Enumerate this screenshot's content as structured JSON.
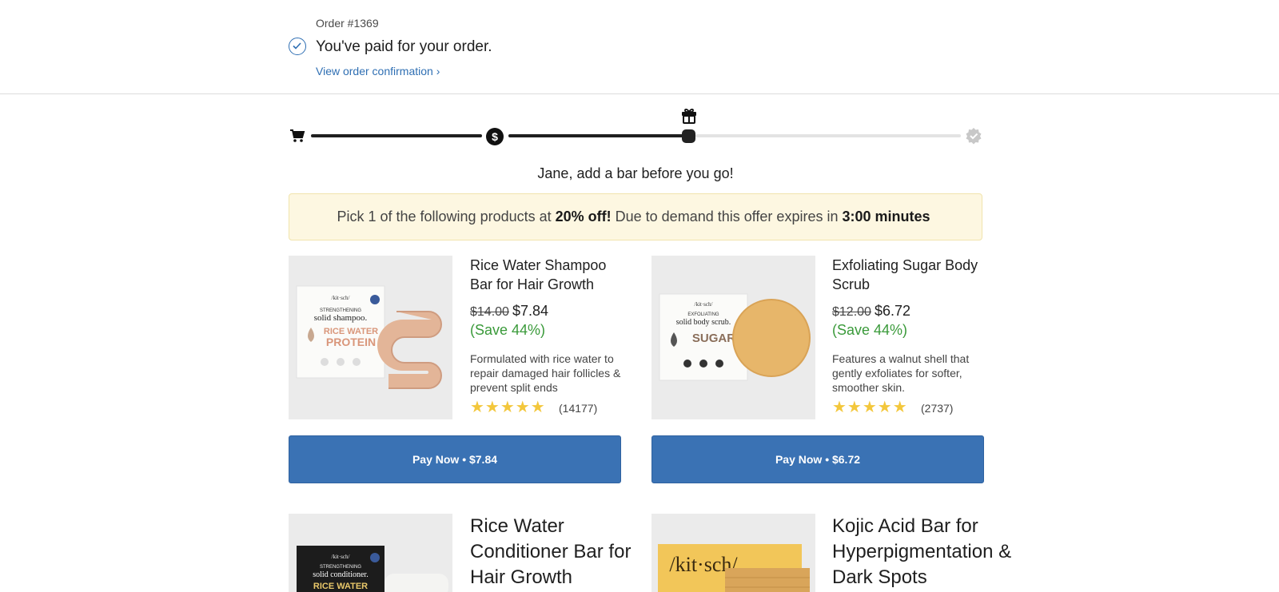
{
  "order": {
    "number": "Order #1369",
    "paid_message": "You've paid for your order.",
    "confirmation_link": "View order confirmation ›"
  },
  "progress": {
    "steps": [
      "cart-icon",
      "dollar-icon",
      "gift-icon",
      "verified-badge-icon"
    ],
    "current_step": 3
  },
  "headline": "Jane, add a bar before you go!",
  "offer": {
    "prefix": "Pick 1 of the following products at",
    "discount": "20% off!",
    "middle": "Due to demand this offer expires in",
    "timer": "3:00 minutes"
  },
  "products": [
    {
      "title": "Rice Water Shampoo Bar for Hair Growth",
      "old_price": "$14.00",
      "new_price": "$7.84",
      "save": "(Save 44%)",
      "description": "Formulated with rice water to repair damaged hair follicles & prevent split ends",
      "rating": 5,
      "stars": "★★★★★",
      "reviews": "(14177)",
      "button": "Pay Now • $7.84",
      "pkg_brand": "/kit·sch/",
      "pkg_line1": "STRENGTHENING",
      "pkg_line2": "solid shampoo.",
      "pkg_line3": "RICE WATER",
      "pkg_line4": "PROTEIN"
    },
    {
      "title": "Exfoliating Sugar Body Scrub",
      "old_price": "$12.00",
      "new_price": "$6.72",
      "save": "(Save 44%)",
      "description": "Features a walnut shell that gently exfoliates for softer, smoother skin.",
      "rating": 5,
      "stars": "★★★★★",
      "reviews": "(2737)",
      "button": "Pay Now • $6.72",
      "pkg_brand": "/kit·sch/",
      "pkg_line1": "EXFOLIATING",
      "pkg_line2": "solid body scrub.",
      "pkg_line3": "SUGAR"
    },
    {
      "title": "Rice Water Conditioner Bar for Hair Growth",
      "pkg_brand": "/kit·sch/",
      "pkg_line1": "STRENGTHENING",
      "pkg_line2": "solid conditioner.",
      "pkg_line3": "RICE WATER"
    },
    {
      "title": "Kojic Acid Bar for Hyperpigmentation & Dark Spots",
      "pkg_brand": "/kit·sch/"
    }
  ],
  "colors": {
    "accent": "#3a72b4",
    "link": "#2f6fb3",
    "save_green": "#3a9a3a",
    "star": "#f3c73c",
    "offer_bg": "#fdf7e1"
  }
}
